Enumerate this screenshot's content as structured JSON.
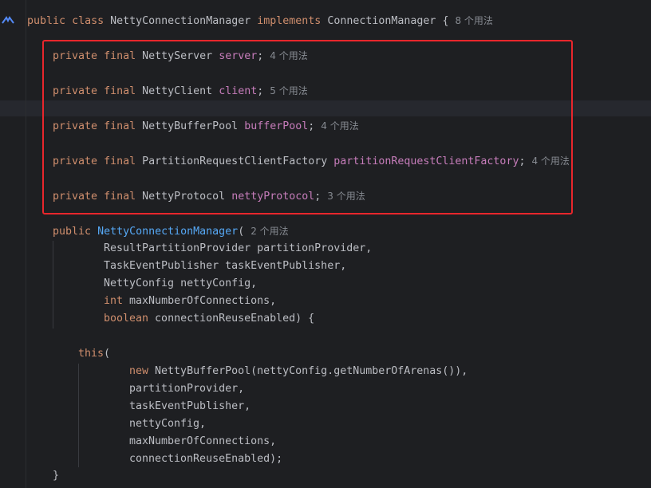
{
  "class_decl": {
    "kw_public": "public",
    "kw_class": "class",
    "name": "NettyConnectionManager",
    "kw_implements": "implements",
    "iface": "ConnectionManager",
    "brace": "{",
    "usages": "8 个用法"
  },
  "fields": [
    {
      "kw_private": "private",
      "kw_final": "final",
      "type": "NettyServer",
      "name": "server",
      "semi": ";",
      "usages": "4 个用法"
    },
    {
      "kw_private": "private",
      "kw_final": "final",
      "type": "NettyClient",
      "name": "client",
      "semi": ";",
      "usages": "5 个用法"
    },
    {
      "kw_private": "private",
      "kw_final": "final",
      "type": "NettyBufferPool",
      "name": "bufferPool",
      "semi": ";",
      "usages": "4 个用法"
    },
    {
      "kw_private": "private",
      "kw_final": "final",
      "type": "PartitionRequestClientFactory",
      "name": "partitionRequestClientFactory",
      "semi": ";",
      "usages": "4 个用法"
    },
    {
      "kw_private": "private",
      "kw_final": "final",
      "type": "NettyProtocol",
      "name": "nettyProtocol",
      "semi": ";",
      "usages": "3 个用法"
    }
  ],
  "constructor": {
    "kw_public": "public",
    "name": "NettyConnectionManager",
    "paren": "(",
    "usages": "2 个用法",
    "params": [
      {
        "kw": "",
        "text": "ResultPartitionProvider partitionProvider,"
      },
      {
        "kw": "",
        "text": "TaskEventPublisher taskEventPublisher,"
      },
      {
        "kw": "",
        "text": "NettyConfig nettyConfig,"
      },
      {
        "kw": "int",
        "text": " maxNumberOfConnections,"
      },
      {
        "kw": "boolean",
        "text": " connectionReuseEnabled) {"
      }
    ],
    "this_kw": "this",
    "this_paren": "(",
    "args": [
      {
        "kw": "new",
        "text": " NettyBufferPool(nettyConfig.getNumberOfArenas()),"
      },
      {
        "kw": "",
        "text": "partitionProvider,"
      },
      {
        "kw": "",
        "text": "taskEventPublisher,"
      },
      {
        "kw": "",
        "text": "nettyConfig,"
      },
      {
        "kw": "",
        "text": "maxNumberOfConnections,"
      },
      {
        "kw": "",
        "text": "connectionReuseEnabled);"
      }
    ],
    "close_brace": "}"
  }
}
